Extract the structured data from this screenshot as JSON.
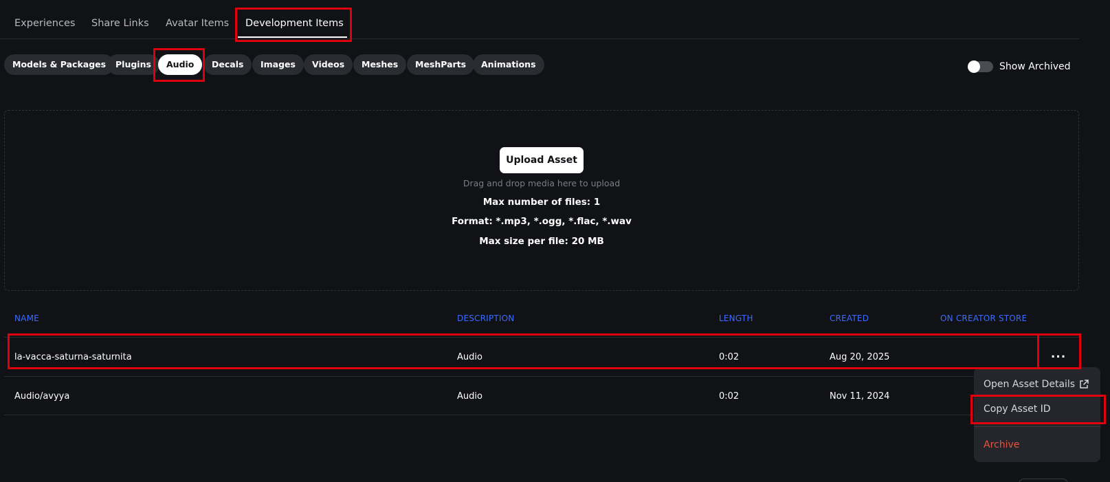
{
  "top_tabs": [
    {
      "label": "Experiences"
    },
    {
      "label": "Share Links"
    },
    {
      "label": "Avatar Items"
    },
    {
      "label": "Development Items",
      "active": true
    }
  ],
  "filters": [
    {
      "label": "Models & Packages"
    },
    {
      "label": "Plugins"
    },
    {
      "label": "Audio",
      "active": true
    },
    {
      "label": "Decals"
    },
    {
      "label": "Images"
    },
    {
      "label": "Videos"
    },
    {
      "label": "Meshes"
    },
    {
      "label": "MeshParts"
    },
    {
      "label": "Animations"
    }
  ],
  "show_archived": {
    "label": "Show Archived",
    "enabled": false
  },
  "dropzone": {
    "upload_label": "Upload Asset",
    "hint": "Drag and drop media here to upload",
    "max_files": "Max number of files: 1",
    "format": "Format: *.mp3, *.ogg, *.flac, *.wav",
    "max_size": "Max size per file: 20 MB"
  },
  "table": {
    "headers": {
      "name": "NAME",
      "description": "DESCRIPTION",
      "length": "LENGTH",
      "created": "CREATED",
      "creator_store": "ON CREATOR STORE"
    },
    "rows": [
      {
        "name": "la-vacca-saturna-saturnita",
        "description": "Audio",
        "length": "0:02",
        "created": "Aug 20, 2025",
        "creator_store": ""
      },
      {
        "name": "Audio/avyya",
        "description": "Audio",
        "length": "0:02",
        "created": "Nov 11, 2024",
        "creator_store": ""
      }
    ],
    "more_label": "..."
  },
  "context_menu": {
    "open_details": "Open Asset Details",
    "copy_id": "Copy Asset ID",
    "archive": "Archive"
  },
  "icons": {
    "external_link": "external-link-icon"
  },
  "colors": {
    "background": "#111216",
    "accent_header": "#3b6cff",
    "danger": "#e6533f",
    "highlight": "#e0000d"
  }
}
